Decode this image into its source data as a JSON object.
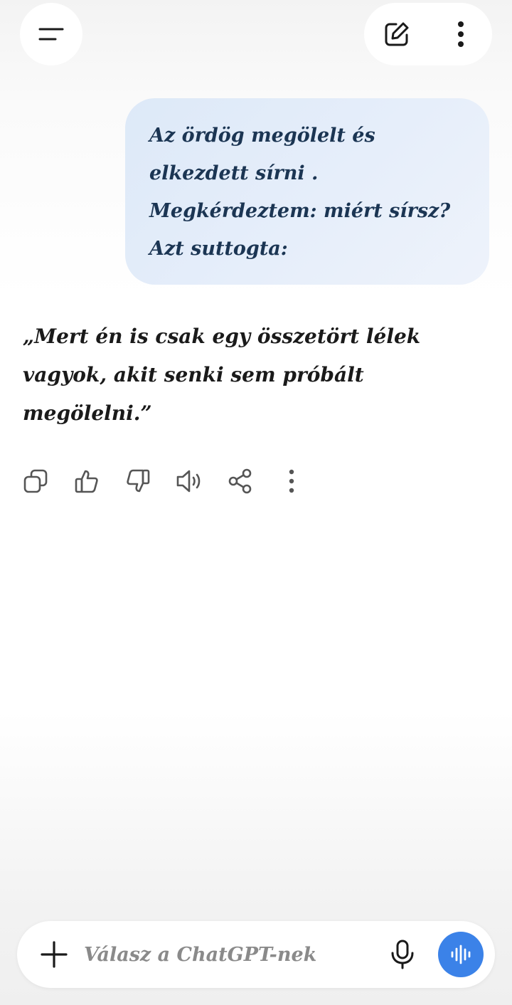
{
  "header": {
    "menu_icon": "hamburger-menu-icon",
    "new_chat_icon": "edit-icon",
    "more_icon": "vertical-dots-icon"
  },
  "conversation": {
    "user_message": "Az ördög megölelt és\nelkezdett sírni .\nMegkérdeztem: miért sírsz?\nAzt suttogta:",
    "assistant_message": "„Mert én is csak egy összetört lélek vagyok, akit senki sem próbált megölelni.”"
  },
  "message_actions": [
    {
      "icon": "copy-icon"
    },
    {
      "icon": "thumbs-up-icon"
    },
    {
      "icon": "thumbs-down-icon"
    },
    {
      "icon": "speaker-icon"
    },
    {
      "icon": "share-icon"
    },
    {
      "icon": "vertical-dots-icon"
    }
  ],
  "composer": {
    "placeholder": "Válasz a ChatGPT-nek",
    "plus_icon": "plus-icon",
    "mic_icon": "microphone-icon",
    "voice_icon": "voice-waveform-icon"
  },
  "colors": {
    "user_bubble": "#e3ecf9",
    "user_text": "#1b3553",
    "voice_button": "#3b82e8",
    "icon": "#555555"
  }
}
